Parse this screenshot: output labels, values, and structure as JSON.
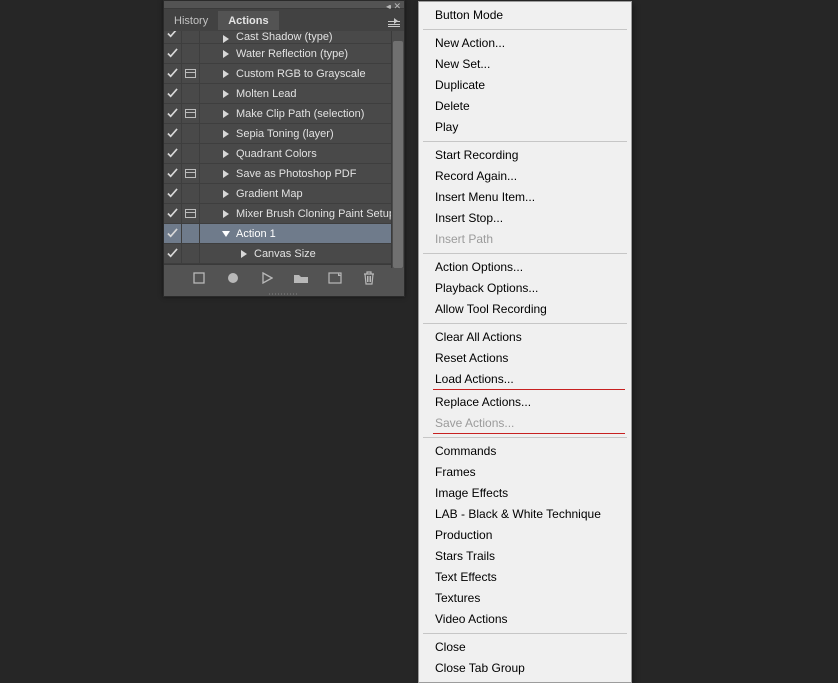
{
  "tabs": {
    "history": "History",
    "actions": "Actions"
  },
  "actions": [
    {
      "name": "Cast Shadow (type)",
      "check": true,
      "dlg": false,
      "indent": 20,
      "expanded": false
    },
    {
      "name": "Water Reflection (type)",
      "check": true,
      "dlg": false,
      "indent": 20,
      "expanded": false
    },
    {
      "name": "Custom RGB to Grayscale",
      "check": true,
      "dlg": true,
      "indent": 20,
      "expanded": false
    },
    {
      "name": "Molten Lead",
      "check": true,
      "dlg": false,
      "indent": 20,
      "expanded": false
    },
    {
      "name": "Make Clip Path (selection)",
      "check": true,
      "dlg": true,
      "indent": 20,
      "expanded": false
    },
    {
      "name": "Sepia Toning (layer)",
      "check": true,
      "dlg": false,
      "indent": 20,
      "expanded": false
    },
    {
      "name": "Quadrant Colors",
      "check": true,
      "dlg": false,
      "indent": 20,
      "expanded": false
    },
    {
      "name": "Save as Photoshop PDF",
      "check": true,
      "dlg": true,
      "indent": 20,
      "expanded": false
    },
    {
      "name": "Gradient Map",
      "check": true,
      "dlg": false,
      "indent": 20,
      "expanded": false
    },
    {
      "name": "Mixer Brush Cloning Paint Setup",
      "check": true,
      "dlg": true,
      "indent": 20,
      "expanded": false
    },
    {
      "name": "Action 1",
      "check": true,
      "dlg": false,
      "indent": 20,
      "expanded": true,
      "selected": true
    },
    {
      "name": "Canvas Size",
      "check": true,
      "dlg": false,
      "indent": 38,
      "expanded": false
    }
  ],
  "menu": [
    [
      {
        "label": "Button Mode"
      }
    ],
    [
      {
        "label": "New Action..."
      },
      {
        "label": "New Set..."
      },
      {
        "label": "Duplicate"
      },
      {
        "label": "Delete"
      },
      {
        "label": "Play"
      }
    ],
    [
      {
        "label": "Start Recording"
      },
      {
        "label": "Record Again..."
      },
      {
        "label": "Insert Menu Item..."
      },
      {
        "label": "Insert Stop..."
      },
      {
        "label": "Insert Path",
        "disabled": true
      }
    ],
    [
      {
        "label": "Action Options..."
      },
      {
        "label": "Playback Options..."
      },
      {
        "label": "Allow Tool Recording"
      }
    ],
    [
      {
        "label": "Clear All Actions"
      },
      {
        "label": "Reset Actions"
      },
      {
        "label": "Load Actions...",
        "underline": true
      },
      {
        "label": "Replace Actions..."
      },
      {
        "label": "Save Actions...",
        "disabled": true,
        "underline": true
      }
    ],
    [
      {
        "label": "Commands"
      },
      {
        "label": "Frames"
      },
      {
        "label": "Image Effects"
      },
      {
        "label": "LAB - Black & White Technique"
      },
      {
        "label": "Production"
      },
      {
        "label": "Stars Trails"
      },
      {
        "label": "Text Effects"
      },
      {
        "label": "Textures"
      },
      {
        "label": "Video Actions"
      }
    ],
    [
      {
        "label": "Close"
      },
      {
        "label": "Close Tab Group"
      }
    ]
  ]
}
